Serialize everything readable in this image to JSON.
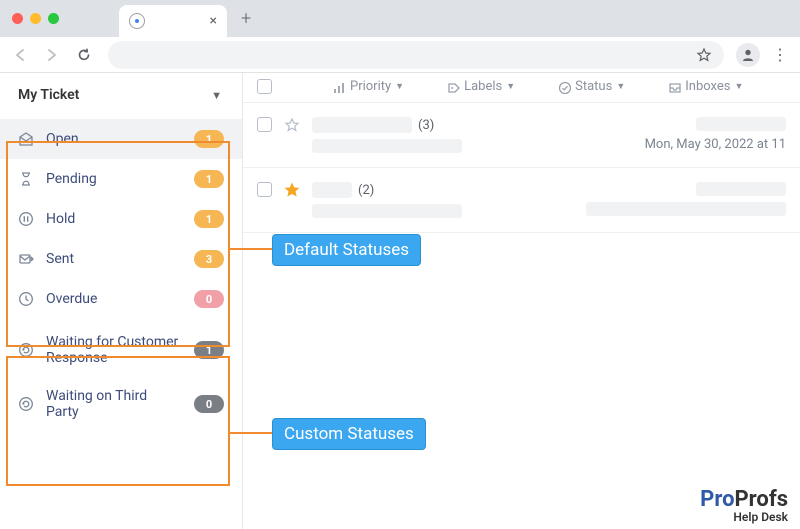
{
  "sidebar": {
    "title": "My Ticket",
    "default_statuses": [
      {
        "icon": "envelope-open",
        "label": "Open",
        "count": "1",
        "badge": "or",
        "active": true
      },
      {
        "icon": "hourglass",
        "label": "Pending",
        "count": "1",
        "badge": "or"
      },
      {
        "icon": "pause",
        "label": "Hold",
        "count": "1",
        "badge": "or"
      },
      {
        "icon": "sent",
        "label": "Sent",
        "count": "3",
        "badge": "or"
      },
      {
        "icon": "clock",
        "label": "Overdue",
        "count": "0",
        "badge": "rd"
      }
    ],
    "custom_statuses": [
      {
        "icon": "refresh",
        "label": "Waiting for Customer Response",
        "count": "1",
        "badge": "gy"
      },
      {
        "icon": "refresh",
        "label": "Waiting on Third Party",
        "count": "0",
        "badge": "gy"
      }
    ]
  },
  "header_cols": {
    "priority": "Priority",
    "labels": "Labels",
    "status": "Status",
    "inboxes": "Inboxes"
  },
  "tickets": [
    {
      "starred": false,
      "count": "(3)",
      "date": "Mon, May 30, 2022 at 11"
    },
    {
      "starred": true,
      "count": "(2)",
      "date": ""
    }
  ],
  "annotations": {
    "default_label": "Default Statuses",
    "custom_label": "Custom Statuses"
  },
  "branding": {
    "p1": "Pro",
    "p2": "Profs",
    "sub": "Help Desk"
  }
}
